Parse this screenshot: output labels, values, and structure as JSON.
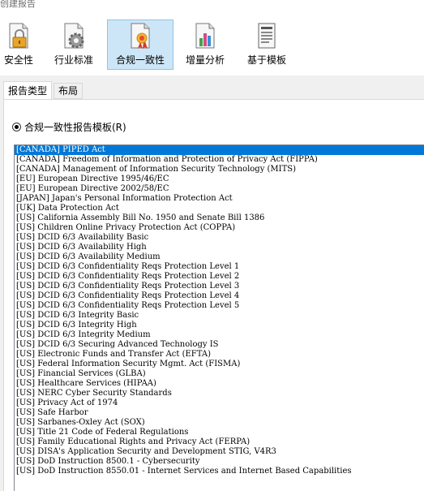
{
  "window": {
    "title": "创建报告"
  },
  "toolbar": {
    "items": [
      {
        "label": "安全性",
        "icon": "lock-document-icon",
        "active": false
      },
      {
        "label": "行业标准",
        "icon": "gear-document-icon",
        "active": false
      },
      {
        "label": "合规一致性",
        "icon": "ribbon-document-icon",
        "active": true
      },
      {
        "label": "增量分析",
        "icon": "chart-document-icon",
        "active": false
      },
      {
        "label": "基于模板",
        "icon": "template-document-icon",
        "active": false
      }
    ]
  },
  "tabs": [
    {
      "label": "报告类型",
      "active": true
    },
    {
      "label": "布局",
      "active": false
    }
  ],
  "radio": {
    "label": "合规一致性报告模板(R)",
    "checked": true
  },
  "list": {
    "selected_index": 0,
    "items": [
      "[CANADA] PIPED Act",
      "[CANADA] Freedom of Information and Protection of Privacy Act (FIPPA)",
      "[CANADA] Management of Information Security Technology (MITS)",
      "[EU] European Directive 1995/46/EC",
      "[EU] European Directive 2002/58/EC",
      "[JAPAN] Japan's Personal Information Protection Act",
      "[UK] Data Protection Act",
      "[US] California Assembly Bill No. 1950 and Senate Bill 1386",
      "[US] Children Online Privacy Protection Act (COPPA)",
      "[US] DCID 6/3 Availability Basic",
      "[US] DCID 6/3 Availability High",
      "[US] DCID 6/3 Availability Medium",
      "[US] DCID 6/3 Confidentiality Reqs Protection Level 1",
      "[US] DCID 6/3 Confidentiality Reqs Protection Level 2",
      "[US] DCID 6/3 Confidentiality Reqs Protection Level 3",
      "[US] DCID 6/3 Confidentiality Reqs Protection Level 4",
      "[US] DCID 6/3 Confidentiality Reqs Protection Level 5",
      "[US] DCID 6/3 Integrity Basic",
      "[US] DCID 6/3 Integrity High",
      "[US] DCID 6/3 Integrity Medium",
      "[US] DCID 6/3 Securing Advanced Technology IS",
      "[US] Electronic Funds and Transfer Act (EFTA)",
      "[US] Federal Information Security Mgmt. Act (FISMA)",
      "[US] Financial Services (GLBA)",
      "[US] Healthcare Services (HIPAA)",
      "[US] NERC Cyber Security Standards",
      "[US] Privacy Act of 1974",
      "[US] Safe Harbor",
      "[US] Sarbanes-Oxley Act (SOX)",
      "[US] Title 21 Code of Federal Regulations",
      "[US] Family Educational Rights and Privacy Act (FERPA)",
      "[US] DISA's Application Security and Development STIG, V4R3",
      "[US] DoD Instruction 8500.1 - Cybersecurity",
      "[US] DoD Instruction 8550.01 - Internet Services and Internet Based Capabilities"
    ]
  }
}
